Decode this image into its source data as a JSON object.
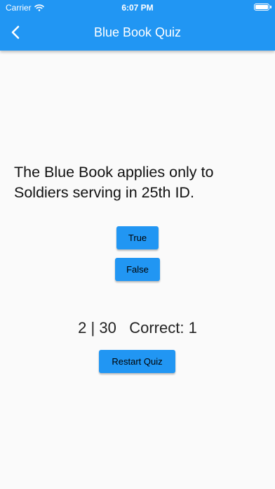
{
  "status_bar": {
    "carrier": "Carrier",
    "time": "6:07 PM"
  },
  "header": {
    "title": "Blue Book Quiz"
  },
  "question": {
    "text": "The Blue Book applies only to Soldiers serving in 25th ID."
  },
  "answers": {
    "true_label": "True",
    "false_label": "False"
  },
  "score": {
    "current": "2",
    "total": "30",
    "correct_label": "Correct:",
    "correct_count": "1"
  },
  "actions": {
    "restart_label": "Restart Quiz"
  },
  "colors": {
    "accent": "#2196f3",
    "background": "#fafafa"
  }
}
